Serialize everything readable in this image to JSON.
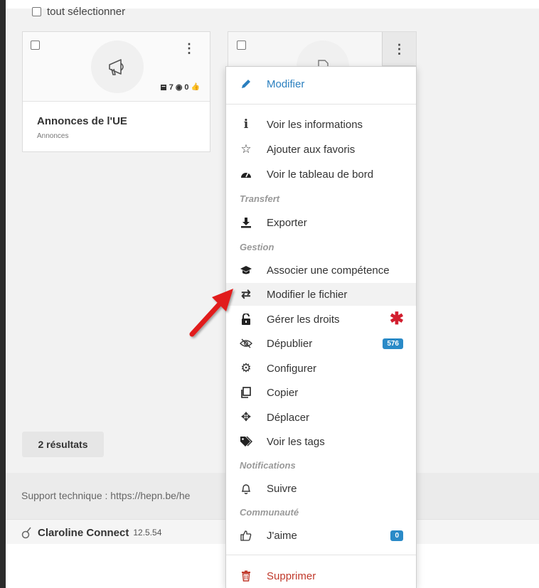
{
  "toolbar": {
    "select_all_label": "tout sélectionner"
  },
  "cards": [
    {
      "title": "Annonces de l'UE",
      "subtitle": "Annonces",
      "stats": {
        "views": "7",
        "likes": "0"
      }
    }
  ],
  "results": {
    "label": "2 résultats"
  },
  "footer": {
    "support_text": "Support technique : https://hepn.be/he",
    "brand_name": "Claroline Connect",
    "version": "12.5.54"
  },
  "menu": {
    "edit": "Modifier",
    "items_general": [
      "Voir les informations",
      "Ajouter aux favoris",
      "Voir le tableau de bord"
    ],
    "section_transfer": "Transfert",
    "export": "Exporter",
    "section_management": "Gestion",
    "items_management": [
      "Associer une compétence",
      "Modifier le fichier",
      "Gérer les droits",
      "Dépublier",
      "Configurer",
      "Copier",
      "Déplacer",
      "Voir les tags"
    ],
    "unpublish_badge": "576",
    "section_notifications": "Notifications",
    "follow": "Suivre",
    "section_community": "Communauté",
    "like": "J'aime",
    "like_badge": "0",
    "delete": "Supprimer"
  },
  "colors": {
    "primary": "#2a7fbf",
    "danger": "#c0392b",
    "badge": "#2a8ac7",
    "annotation": "#e11d1d"
  }
}
